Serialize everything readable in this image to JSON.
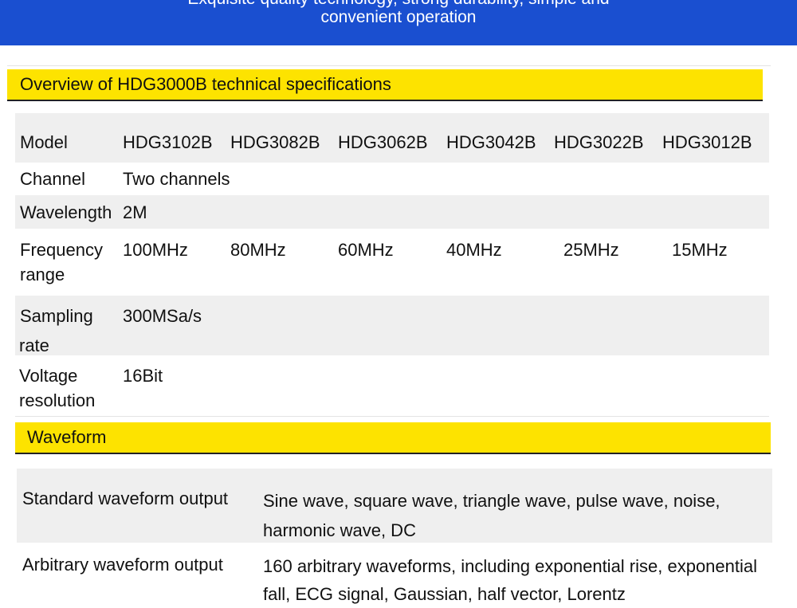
{
  "banner": {
    "line1": "Exquisite quality technology, strong durability, simple and",
    "line2": "convenient operation"
  },
  "overview": {
    "title": "Overview of HDG3000B technical specifications",
    "rows": [
      {
        "label": "Model",
        "values": [
          "HDG3102B",
          "HDG3082B",
          "HDG3062B",
          "HDG3042B",
          "HDG3022B",
          "HDG3012B"
        ]
      },
      {
        "label": "Channel",
        "values": [
          "Two channels"
        ]
      },
      {
        "label": "Wavelength",
        "values": [
          "2M"
        ]
      },
      {
        "label": "Frequency range",
        "values": [
          "100MHz",
          "80MHz",
          "60MHz",
          "40MHz",
          "25MHz",
          "15MHz"
        ]
      },
      {
        "label_line1": "Sampling",
        "label_line2": "rate",
        "values": [
          "300MSa/s"
        ]
      },
      {
        "label": "Voltage resolution",
        "values": [
          "16Bit"
        ]
      }
    ]
  },
  "waveform": {
    "title": "Waveform",
    "rows": [
      {
        "label": "Standard waveform output",
        "value": "Sine wave, square wave, triangle wave, pulse wave, noise, harmonic wave, DC"
      },
      {
        "label": "Arbitrary waveform output",
        "value": "160 arbitrary waveforms, including exponential rise, exponential fall, ECG signal, Gaussian, half vector, Lorentz"
      }
    ]
  }
}
